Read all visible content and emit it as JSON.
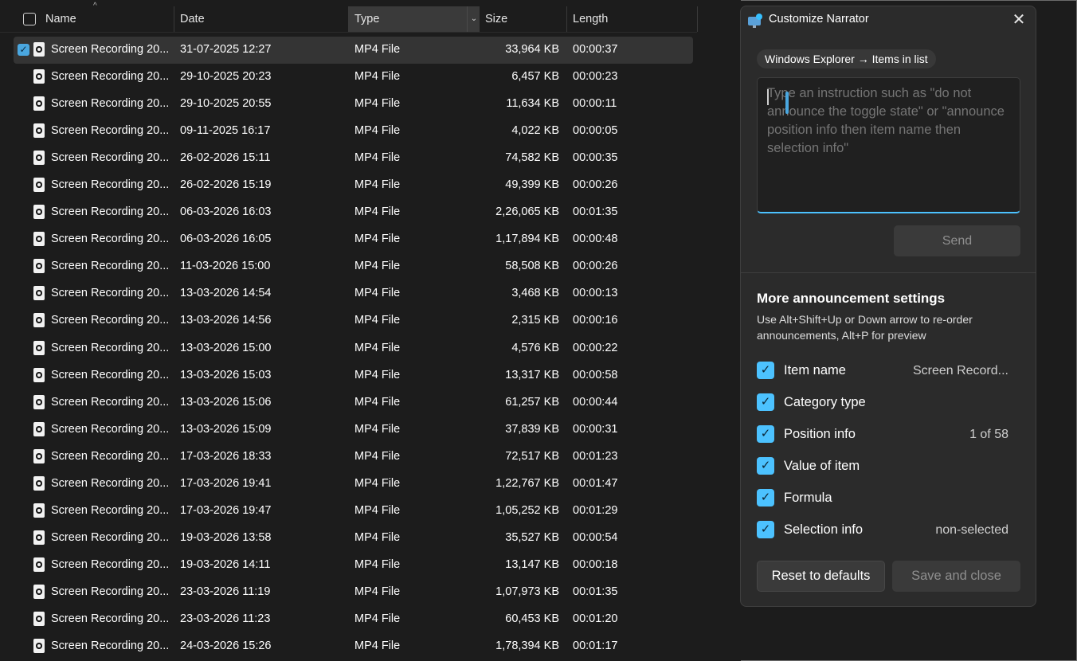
{
  "file_list": {
    "columns": {
      "name": "Name",
      "date": "Date",
      "type": "Type",
      "size": "Size",
      "length": "Length"
    },
    "rows": [
      {
        "name": "Screen Recording 20...",
        "date": "31-07-2025 12:27",
        "type": "MP4 File",
        "size": "33,964 KB",
        "length": "00:00:37",
        "selected": true
      },
      {
        "name": "Screen Recording 20...",
        "date": "29-10-2025 20:23",
        "type": "MP4 File",
        "size": "6,457 KB",
        "length": "00:00:23"
      },
      {
        "name": "Screen Recording 20...",
        "date": "29-10-2025 20:55",
        "type": "MP4 File",
        "size": "11,634 KB",
        "length": "00:00:11"
      },
      {
        "name": "Screen Recording 20...",
        "date": "09-11-2025 16:17",
        "type": "MP4 File",
        "size": "4,022 KB",
        "length": "00:00:05"
      },
      {
        "name": "Screen Recording 20...",
        "date": "26-02-2026 15:11",
        "type": "MP4 File",
        "size": "74,582 KB",
        "length": "00:00:35"
      },
      {
        "name": "Screen Recording 20...",
        "date": "26-02-2026 15:19",
        "type": "MP4 File",
        "size": "49,399 KB",
        "length": "00:00:26"
      },
      {
        "name": "Screen Recording 20...",
        "date": "06-03-2026 16:03",
        "type": "MP4 File",
        "size": "2,26,065 KB",
        "length": "00:01:35"
      },
      {
        "name": "Screen Recording 20...",
        "date": "06-03-2026 16:05",
        "type": "MP4 File",
        "size": "1,17,894 KB",
        "length": "00:00:48"
      },
      {
        "name": "Screen Recording 20...",
        "date": "11-03-2026 15:00",
        "type": "MP4 File",
        "size": "58,508 KB",
        "length": "00:00:26"
      },
      {
        "name": "Screen Recording 20...",
        "date": "13-03-2026 14:54",
        "type": "MP4 File",
        "size": "3,468 KB",
        "length": "00:00:13"
      },
      {
        "name": "Screen Recording 20...",
        "date": "13-03-2026 14:56",
        "type": "MP4 File",
        "size": "2,315 KB",
        "length": "00:00:16"
      },
      {
        "name": "Screen Recording 20...",
        "date": "13-03-2026 15:00",
        "type": "MP4 File",
        "size": "4,576 KB",
        "length": "00:00:22"
      },
      {
        "name": "Screen Recording 20...",
        "date": "13-03-2026 15:03",
        "type": "MP4 File",
        "size": "13,317 KB",
        "length": "00:00:58"
      },
      {
        "name": "Screen Recording 20...",
        "date": "13-03-2026 15:06",
        "type": "MP4 File",
        "size": "61,257 KB",
        "length": "00:00:44"
      },
      {
        "name": "Screen Recording 20...",
        "date": "13-03-2026 15:09",
        "type": "MP4 File",
        "size": "37,839 KB",
        "length": "00:00:31"
      },
      {
        "name": "Screen Recording 20...",
        "date": "17-03-2026 18:33",
        "type": "MP4 File",
        "size": "72,517 KB",
        "length": "00:01:23"
      },
      {
        "name": "Screen Recording 20...",
        "date": "17-03-2026 19:41",
        "type": "MP4 File",
        "size": "1,22,767 KB",
        "length": "00:01:47"
      },
      {
        "name": "Screen Recording 20...",
        "date": "17-03-2026 19:47",
        "type": "MP4 File",
        "size": "1,05,252 KB",
        "length": "00:01:29"
      },
      {
        "name": "Screen Recording 20...",
        "date": "19-03-2026 13:58",
        "type": "MP4 File",
        "size": "35,527 KB",
        "length": "00:00:54"
      },
      {
        "name": "Screen Recording 20...",
        "date": "19-03-2026 14:11",
        "type": "MP4 File",
        "size": "13,147 KB",
        "length": "00:00:18"
      },
      {
        "name": "Screen Recording 20...",
        "date": "23-03-2026 11:19",
        "type": "MP4 File",
        "size": "1,07,973 KB",
        "length": "00:01:35"
      },
      {
        "name": "Screen Recording 20...",
        "date": "23-03-2026 11:23",
        "type": "MP4 File",
        "size": "60,453 KB",
        "length": "00:01:20"
      },
      {
        "name": "Screen Recording 20...",
        "date": "24-03-2026 15:26",
        "type": "MP4 File",
        "size": "1,78,394 KB",
        "length": "00:01:17"
      }
    ]
  },
  "narrator_dialog": {
    "title": "Customize Narrator",
    "context_chip": "Windows Explorer → Items in list",
    "instruction_placeholder": "Type an instruction such as \"do not announce the toggle state\" or \"announce position info then item name then selection info\"",
    "send_label": "Send",
    "section_title": "More announcement settings",
    "section_desc": "Use Alt+Shift+Up or Down arrow to re-order announcements, Alt+P for preview",
    "options": [
      {
        "label": "Item name",
        "value": "Screen Record...",
        "checked": true
      },
      {
        "label": "Category type",
        "value": "",
        "checked": true
      },
      {
        "label": "Position info",
        "value": "1 of 58",
        "checked": true
      },
      {
        "label": "Value of item",
        "value": "",
        "checked": true
      },
      {
        "label": "Formula",
        "value": "",
        "checked": true
      },
      {
        "label": "Selection info",
        "value": "non-selected",
        "checked": true
      }
    ],
    "reset_label": "Reset to defaults",
    "save_close_label": "Save and close"
  },
  "colors": {
    "accent": "#4cc2ff",
    "background": "#1c1c1c",
    "dialog_bg": "#2b2b2b"
  }
}
